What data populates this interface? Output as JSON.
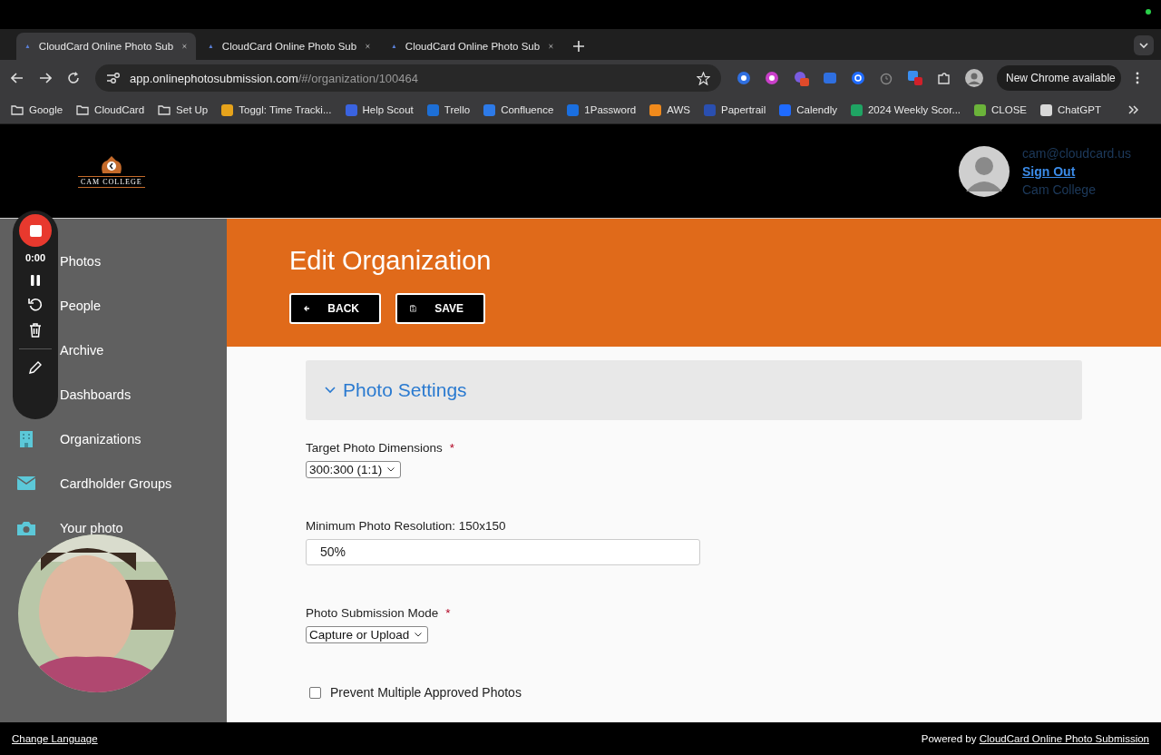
{
  "browser": {
    "tabs": [
      {
        "title": "CloudCard Online Photo Sub",
        "selected": true
      },
      {
        "title": "CloudCard Online Photo Sub",
        "selected": false
      },
      {
        "title": "CloudCard Online Photo Sub",
        "selected": false
      }
    ],
    "url_host": "app.onlinephotosubmission.com",
    "url_path": "/#/organization/100464",
    "update_label": "New Chrome available",
    "bookmarks": [
      {
        "label": "Google",
        "kind": "folder"
      },
      {
        "label": "CloudCard",
        "kind": "folder"
      },
      {
        "label": "Set Up",
        "kind": "folder"
      },
      {
        "label": "Toggl: Time Tracki...",
        "kind": "site",
        "color": "#e6a31b"
      },
      {
        "label": "Help Scout",
        "kind": "site",
        "color": "#3a63e0"
      },
      {
        "label": "Trello",
        "kind": "site",
        "color": "#1d6fd6"
      },
      {
        "label": "Confluence",
        "kind": "site",
        "color": "#2d7ae8"
      },
      {
        "label": "1Password",
        "kind": "site",
        "color": "#1a6fe0"
      },
      {
        "label": "AWS",
        "kind": "site",
        "color": "#f08a1c"
      },
      {
        "label": "Papertrail",
        "kind": "site",
        "color": "#2a4fb0"
      },
      {
        "label": "Calendly",
        "kind": "site",
        "color": "#1f6bff"
      },
      {
        "label": "2024 Weekly Scor...",
        "kind": "site",
        "color": "#1fa463"
      },
      {
        "label": "CLOSE",
        "kind": "site",
        "color": "#6bb33a"
      },
      {
        "label": "ChatGPT",
        "kind": "site",
        "color": "#d8d8d8"
      }
    ]
  },
  "header": {
    "logo_text": "CAM COLLEGE",
    "email": "cam@cloudcard.us",
    "sign_out": "Sign Out",
    "organization": "Cam College"
  },
  "sidebar": {
    "items": [
      {
        "label": "Photos"
      },
      {
        "label": "People"
      },
      {
        "label": "Archive"
      },
      {
        "label": "Dashboards"
      },
      {
        "label": "Organizations"
      },
      {
        "label": "Cardholder Groups"
      },
      {
        "label": "Your photo"
      }
    ]
  },
  "recorder": {
    "time": "0:00"
  },
  "page": {
    "title": "Edit Organization",
    "buttons": [
      {
        "label": "BACK",
        "kind": "back"
      },
      {
        "label": "SAVE",
        "kind": "save"
      }
    ],
    "section": {
      "title": "Photo Settings",
      "expanded": true
    },
    "fields": [
      {
        "kind": "select",
        "label": "Target Photo Dimensions",
        "required_mark": "*",
        "value": "300:300 (1:1)"
      },
      {
        "kind": "text",
        "label": "Minimum Photo Resolution: 150x150",
        "value": "50%"
      },
      {
        "kind": "select",
        "label": "Photo Submission Mode",
        "required_mark": "*",
        "value": "Capture or Upload"
      },
      {
        "kind": "checkbox",
        "label": "Prevent Multiple Approved Photos",
        "checked": false
      }
    ]
  },
  "footer": {
    "change_language": "Change Language",
    "powered_prefix": "Powered by",
    "powered_link": "CloudCard Online Photo Submission"
  }
}
